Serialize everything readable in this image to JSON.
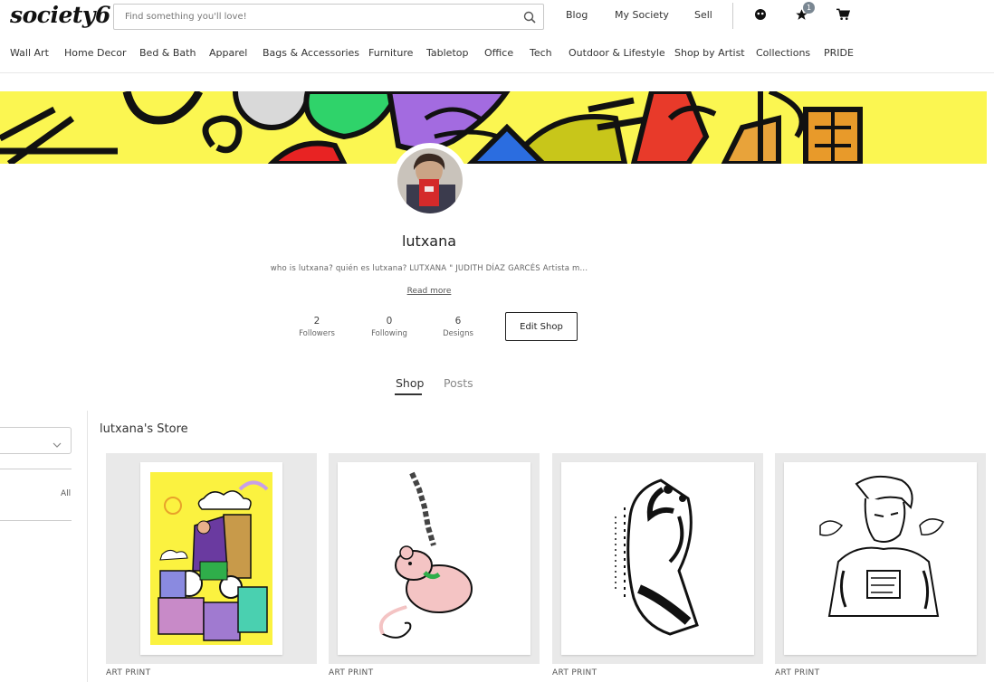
{
  "header": {
    "logo": "society6",
    "search_placeholder": "Find something you'll love!",
    "links": [
      "Blog",
      "My Society",
      "Sell"
    ],
    "cart_badge": "1"
  },
  "nav": [
    "Wall Art",
    "Home Decor",
    "Bed & Bath",
    "Apparel",
    "Bags & Accessories",
    "Furniture",
    "Tabletop",
    "Office",
    "Tech",
    "Outdoor & Lifestyle",
    "Shop by Artist",
    "Collections",
    "PRIDE"
  ],
  "profile": {
    "username": "lutxana",
    "bio": "who is lutxana? quién es lutxana? LUTXANA \" JUDITH DÍAZ GARCÉS Artista m...",
    "read_more": "Read more",
    "stats": [
      {
        "value": "2",
        "label": "Followers"
      },
      {
        "value": "0",
        "label": "Following"
      },
      {
        "value": "6",
        "label": "Designs"
      }
    ],
    "edit_button": "Edit Shop"
  },
  "tabs": {
    "shop": "Shop",
    "posts": "Posts"
  },
  "sidebar": {
    "filter_all": "All"
  },
  "store": {
    "title": "lutxana's Store",
    "products": [
      {
        "label": "ART PRINT"
      },
      {
        "label": "ART PRINT"
      },
      {
        "label": "ART PRINT"
      },
      {
        "label": "ART PRINT"
      }
    ]
  },
  "colors": {
    "banner_yellow": "#fbf651",
    "badge": "#7a8792"
  }
}
